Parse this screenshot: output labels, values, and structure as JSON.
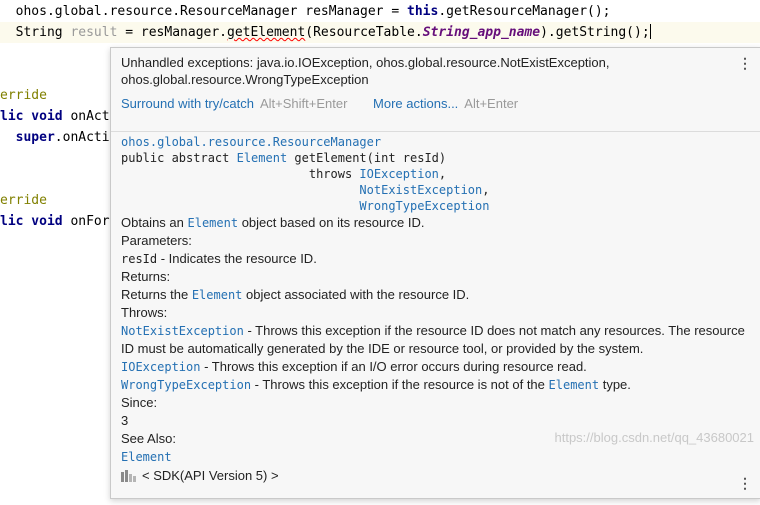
{
  "editor": {
    "line1": {
      "pkg": "ohos.global.resource.ResourceManager resManager = ",
      "kw_this": "this",
      "rest": ".getResourceManager();"
    },
    "line2": {
      "type": "String ",
      "var": "result",
      "eq": " = resManager.",
      "method": "getElement",
      "arg_open": "(ResourceTable.",
      "field": "String_app_name",
      "tail": ").getString();"
    },
    "line3": {
      "ann": "erride"
    },
    "line4": {
      "kw": "lic void",
      "name": " onAct"
    },
    "line5": {
      "kw": "super",
      "name": ".onActiv"
    },
    "line6": {
      "ann": "erride"
    },
    "line7": {
      "kw": "lic void",
      "name": " onFor"
    }
  },
  "popup": {
    "error_message": "Unhandled exceptions: java.io.IOException, ohos.global.resource.NotExistException, ohos.global.resource.WrongTypeException",
    "menu_glyph": "⋮",
    "action1_label": "Surround with try/catch",
    "action1_shortcut": "Alt+Shift+Enter",
    "action2_label": "More actions...",
    "action2_shortcut": "Alt+Enter"
  },
  "doc": {
    "class_link": "ohos.global.resource.ResourceManager",
    "sig_prefix": "public abstract ",
    "return_type": "Element",
    "sig_method": " getElement(int resId)",
    "throws_kw": "throws ",
    "exc1": "IOException",
    "exc2": "NotExistException",
    "exc3": "WrongTypeException",
    "comma": ",",
    "desc_pre": "Obtains an ",
    "desc_link": "Element",
    "desc_post": " object based on its resource ID.",
    "params_heading": "Parameters:",
    "param_name": "resId",
    "param_desc": " - Indicates the resource ID.",
    "returns_heading": "Returns:",
    "returns_pre": "Returns the ",
    "returns_link": "Element",
    "returns_post": " object associated with the resource ID.",
    "throws_heading": "Throws:",
    "t1_name": "NotExistException",
    "t1_desc": " - Throws this exception if the resource ID does not match any resources. The resource ID must be automatically generated by the IDE or resource tool, or provided by the system.",
    "t2_name": "IOException",
    "t2_desc": " - Throws this exception if an I/O error occurs during resource read.",
    "t3_name": "WrongTypeException",
    "t3_desc_pre": " - Throws this exception if the resource is not of the ",
    "t3_link": "Element",
    "t3_desc_post": " type.",
    "since_heading": "Since:",
    "since_value": "3",
    "see_heading": "See Also:",
    "see_link": "Element"
  },
  "footer": {
    "sdk_label": "< SDK(API Version 5) >",
    "icon": "library-icon"
  },
  "watermark": "https://blog.csdn.net/qq_43680021"
}
